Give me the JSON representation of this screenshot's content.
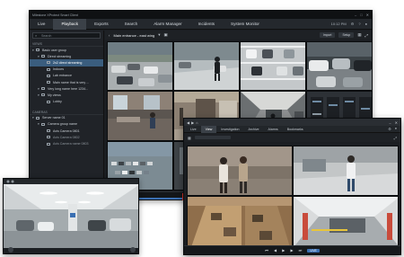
{
  "main_window": {
    "title": "Milestone XProtect Smart Client",
    "nav_tabs": [
      {
        "label": "Live",
        "active": false
      },
      {
        "label": "Playback",
        "active": true
      },
      {
        "label": "Exports",
        "active": false
      },
      {
        "label": "Search",
        "active": false
      },
      {
        "label": "Alarm Manager",
        "active": false
      },
      {
        "label": "Incidents",
        "active": false
      },
      {
        "label": "System Monitor",
        "active": false
      }
    ],
    "nav_right": {
      "time": "10:12 PM"
    },
    "sidebar": {
      "search_placeholder": "Search",
      "views_header": "VIEWS",
      "views": [
        {
          "label": "Basic user group",
          "level": 0,
          "state": "normal"
        },
        {
          "label": "Direct streaming",
          "level": 1,
          "state": "normal"
        },
        {
          "label": "2x2 direct streaming",
          "level": 2,
          "state": "selected"
        },
        {
          "label": "Indoors",
          "level": 2,
          "state": "normal"
        },
        {
          "label": "Lab entrance",
          "level": 2,
          "state": "normal"
        },
        {
          "label": "Main name that is very ...",
          "level": 2,
          "state": "normal"
        },
        {
          "label": "Very long name here 1234...",
          "level": 1,
          "state": "normal"
        },
        {
          "label": "My views",
          "level": 1,
          "state": "normal"
        },
        {
          "label": "Lobby",
          "level": 2,
          "state": "normal"
        }
      ],
      "cameras_header": "CAMERAS",
      "cameras": [
        {
          "label": "Server name 01",
          "level": 0,
          "state": "normal"
        },
        {
          "label": "Camera group name",
          "level": 1,
          "state": "normal"
        },
        {
          "label": "Axis Camera 0801",
          "level": 2,
          "state": "normal"
        },
        {
          "label": "Axis Camera 0802",
          "level": 2,
          "state": "dim"
        },
        {
          "label": "Axis Camera name 0803",
          "level": 2,
          "state": "dim"
        }
      ]
    },
    "toolbar": {
      "view_name": "Main entrance - east wing",
      "import_label": "Import",
      "setup_label": "Setup"
    }
  },
  "right_window": {
    "nav_tabs": [
      {
        "label": "Live",
        "active": false
      },
      {
        "label": "View",
        "active": true
      },
      {
        "label": "Investigation",
        "active": false
      },
      {
        "label": "Archive",
        "active": false
      },
      {
        "label": "Alarms",
        "active": false
      },
      {
        "label": "Bookmarks",
        "active": false
      }
    ],
    "live_label": "LIVE"
  },
  "colors": {
    "accent": "#3a6fb2",
    "selection": "#3a5d7e",
    "window_bg": "#1b1e22",
    "playhead": "#d8322a"
  },
  "icons": [
    "search-icon",
    "settings-icon",
    "minimize-icon",
    "close-icon",
    "play-icon",
    "pause-icon",
    "fullscreen-icon"
  ]
}
